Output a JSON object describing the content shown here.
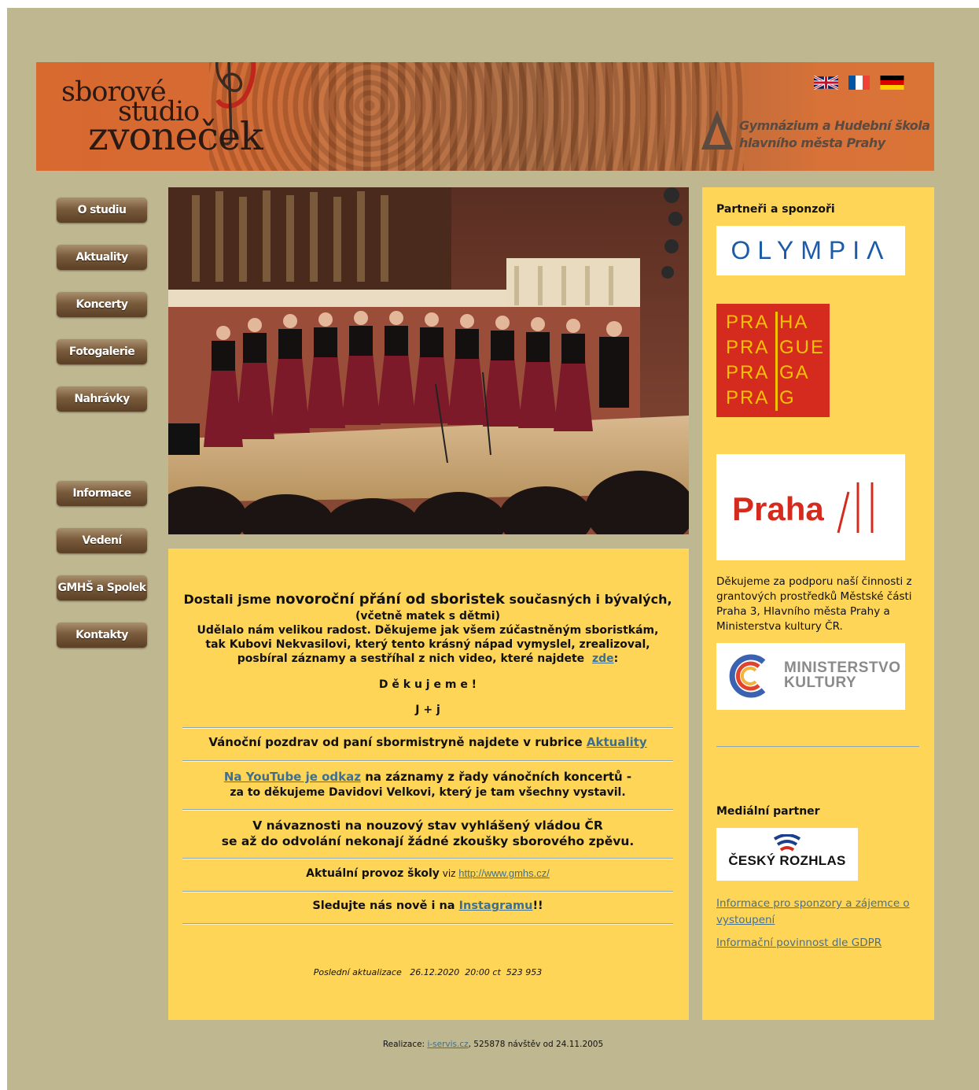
{
  "header": {
    "logo": {
      "line1": "sborové",
      "line2": "studio",
      "line3": "zvoneček"
    },
    "languages": [
      {
        "name": "English",
        "icon": "uk-flag-icon"
      },
      {
        "name": "Français",
        "icon": "france-flag-icon"
      },
      {
        "name": "Deutsch",
        "icon": "germany-flag-icon"
      }
    ],
    "school": {
      "line1": "Gymnázium a Hudební škola",
      "line2": "hlavního města Prahy"
    }
  },
  "nav": {
    "items": [
      {
        "label": "O studiu"
      },
      {
        "label": "Aktuality"
      },
      {
        "label": "Koncerty"
      },
      {
        "label": "Fotogalerie"
      },
      {
        "label": "Nahrávky"
      },
      {
        "label": "Informace"
      },
      {
        "label": "Vedení"
      },
      {
        "label": "GMHŠ a Spolek"
      },
      {
        "label": "Kontakty"
      }
    ]
  },
  "main": {
    "news1": {
      "p1_a": "Dostali jsme ",
      "p1_b": "novoroční přání od sboristek",
      "p1_c": " současných i bývalých,",
      "p2": "(včetně matek s dětmi)",
      "p3": "Udělalo nám velikou radost. Děkujeme jak všem zúčastněným sboristkám,",
      "p4": "tak Kubovi Nekvasilovi, který tento krásný nápad vymyslel, zrealizoval,",
      "p5": "posbíral záznamy a sestříhal z nich video, které najdete",
      "link": "zde",
      "p5_end": ":",
      "thanks": "D ě k u j e m e !",
      "sign": "J + j"
    },
    "news2": {
      "text": "Vánoční pozdrav od paní sbormistryně najdete v rubrice ",
      "link": "Aktuality"
    },
    "news3": {
      "link": "Na YouTube je odkaz",
      "text": " na záznamy z řady vánočních koncertů -",
      "text2": "za to děkujeme Davidovi Velkovi, který je tam všechny vystavil."
    },
    "news4": {
      "line1": "V návaznosti na nouzový stav vyhlášený vládou ČR",
      "line2": "se až do odvolání nekonají žádné zkoušky sborového zpěvu."
    },
    "news5": {
      "text": "Aktuální provoz školy",
      "viz": " viz ",
      "link": "http://www.gmhs.cz/"
    },
    "news6": {
      "text": "Sledujte nás nově i na ",
      "link": "Instagramu",
      "end": "!!"
    },
    "update": "Poslední aktualizace   26.12.2020  20:00 ct  523 953"
  },
  "sidebar": {
    "partners_title": "Partneři a sponzoři",
    "olympia": "OLYMPIΛ",
    "praha_logo": {
      "left": [
        "PRA",
        "PRA",
        "PRA",
        "PRA"
      ],
      "right": [
        "HA",
        "GUE",
        "GA",
        "G"
      ]
    },
    "praha3": "Praha",
    "thanks_text": "Děkujeme za podporu naší činnosti z grantových prostředků Městské části Praha 3, Hlavního města Prahy a Ministerstva kultury ČR.",
    "ministry": {
      "line1": "MINISTERSTVO",
      "line2": "KULTURY"
    },
    "media_title": "Mediální partner",
    "radio": "ČESKÝ ROZHLAS",
    "link1": "Informace pro sponzory a zájemce o vystoupení",
    "link2": "Informační povinnost dle GDPR"
  },
  "footer": {
    "prefix": "Realizace: ",
    "link": "i-servis.cz",
    "suffix": ", 525878 návštěv od 24.11.2005"
  }
}
